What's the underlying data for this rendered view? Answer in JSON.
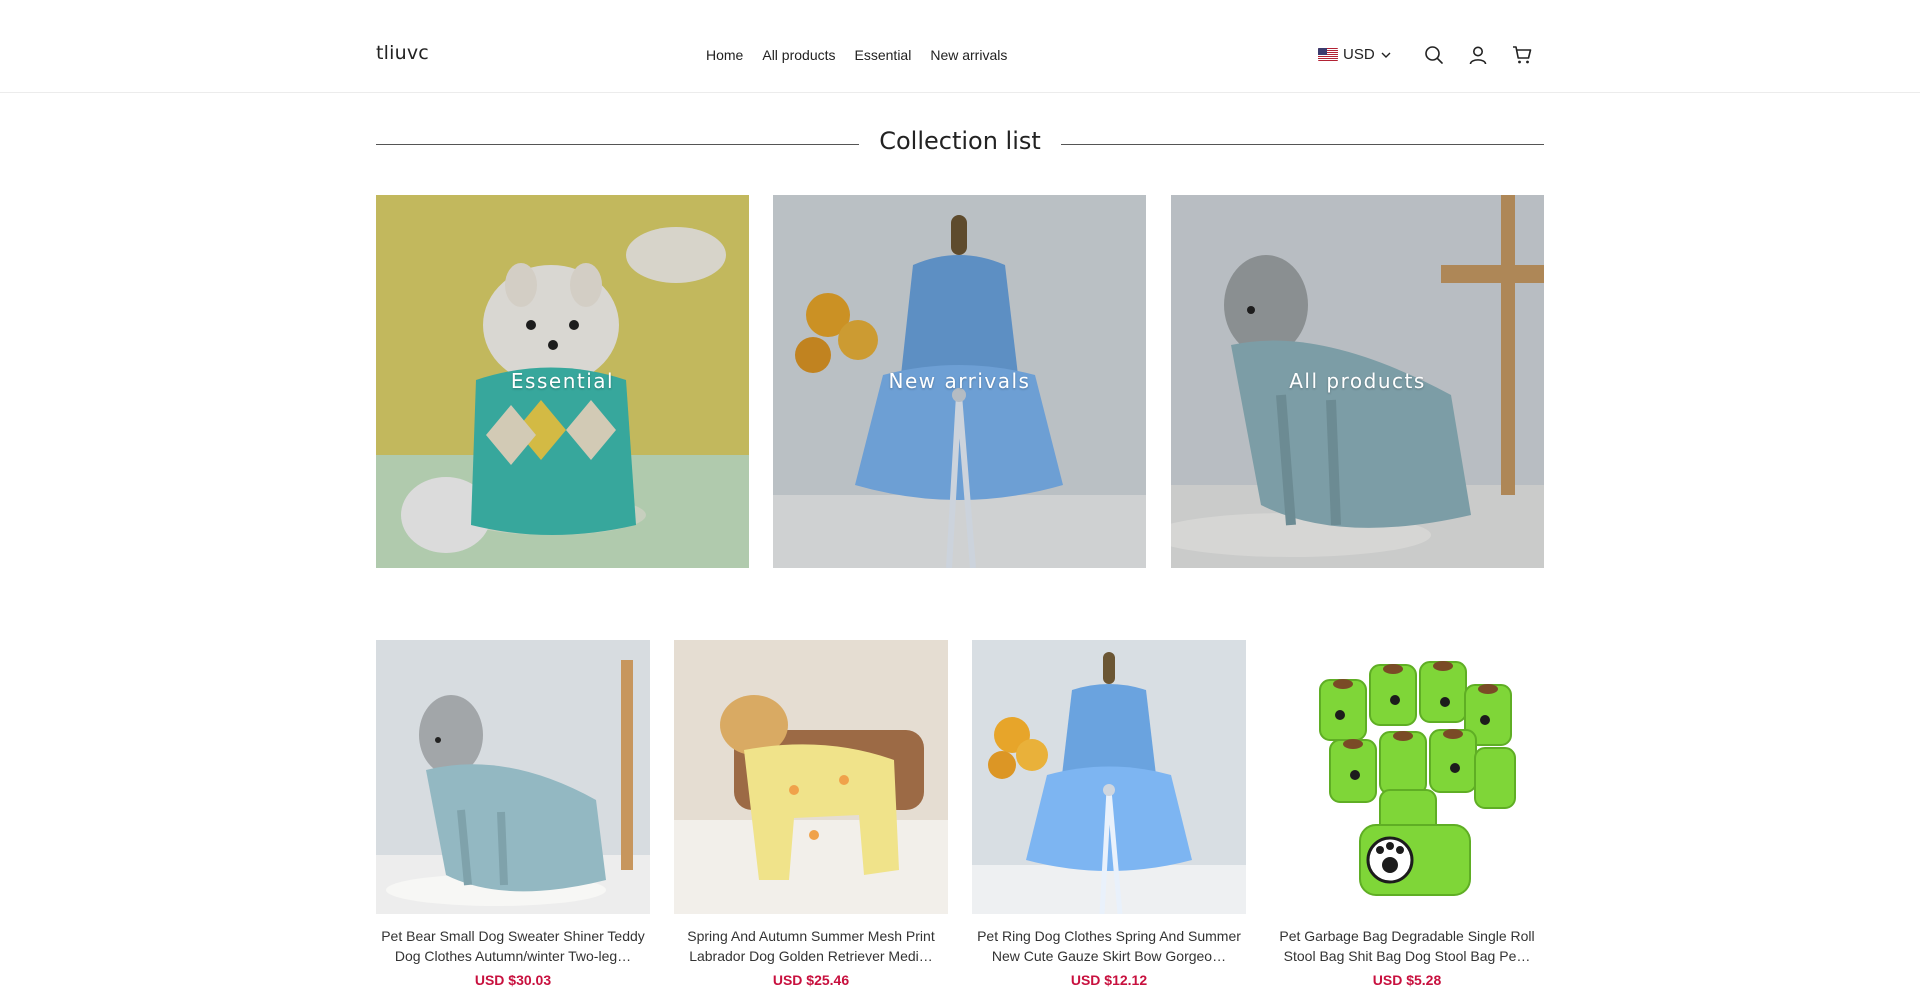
{
  "store": {
    "name": "tliuvc"
  },
  "nav": {
    "items": [
      "Home",
      "All products",
      "Essential",
      "New arrivals"
    ]
  },
  "currency": {
    "code": "USD",
    "flag_icon": "us-flag-icon"
  },
  "header_icons": [
    "search-icon",
    "account-icon",
    "cart-icon"
  ],
  "collections_section": {
    "title": "Collection list",
    "items": [
      {
        "label": "Essential"
      },
      {
        "label": "New arrivals"
      },
      {
        "label": "All products"
      }
    ]
  },
  "products": [
    {
      "title": "Pet Bear Small Dog Sweater Shiner Teddy Dog Clothes Autumn/winter Two-leg…",
      "price": "USD $30.03"
    },
    {
      "title": "Spring And Autumn Summer Mesh Print Labrador Dog Golden Retriever Medi…",
      "price": "USD $25.46"
    },
    {
      "title": "Pet Ring Dog Clothes Spring And Summer New Cute Gauze Skirt Bow Gorgeo…",
      "price": "USD $12.12"
    },
    {
      "title": "Pet Garbage Bag Degradable Single Roll Stool Bag Shit Bag Dog Stool Bag Pe…",
      "price": "USD $5.28"
    }
  ],
  "colors": {
    "price": "#c8103e",
    "text": "#222222",
    "border": "#ececec"
  }
}
